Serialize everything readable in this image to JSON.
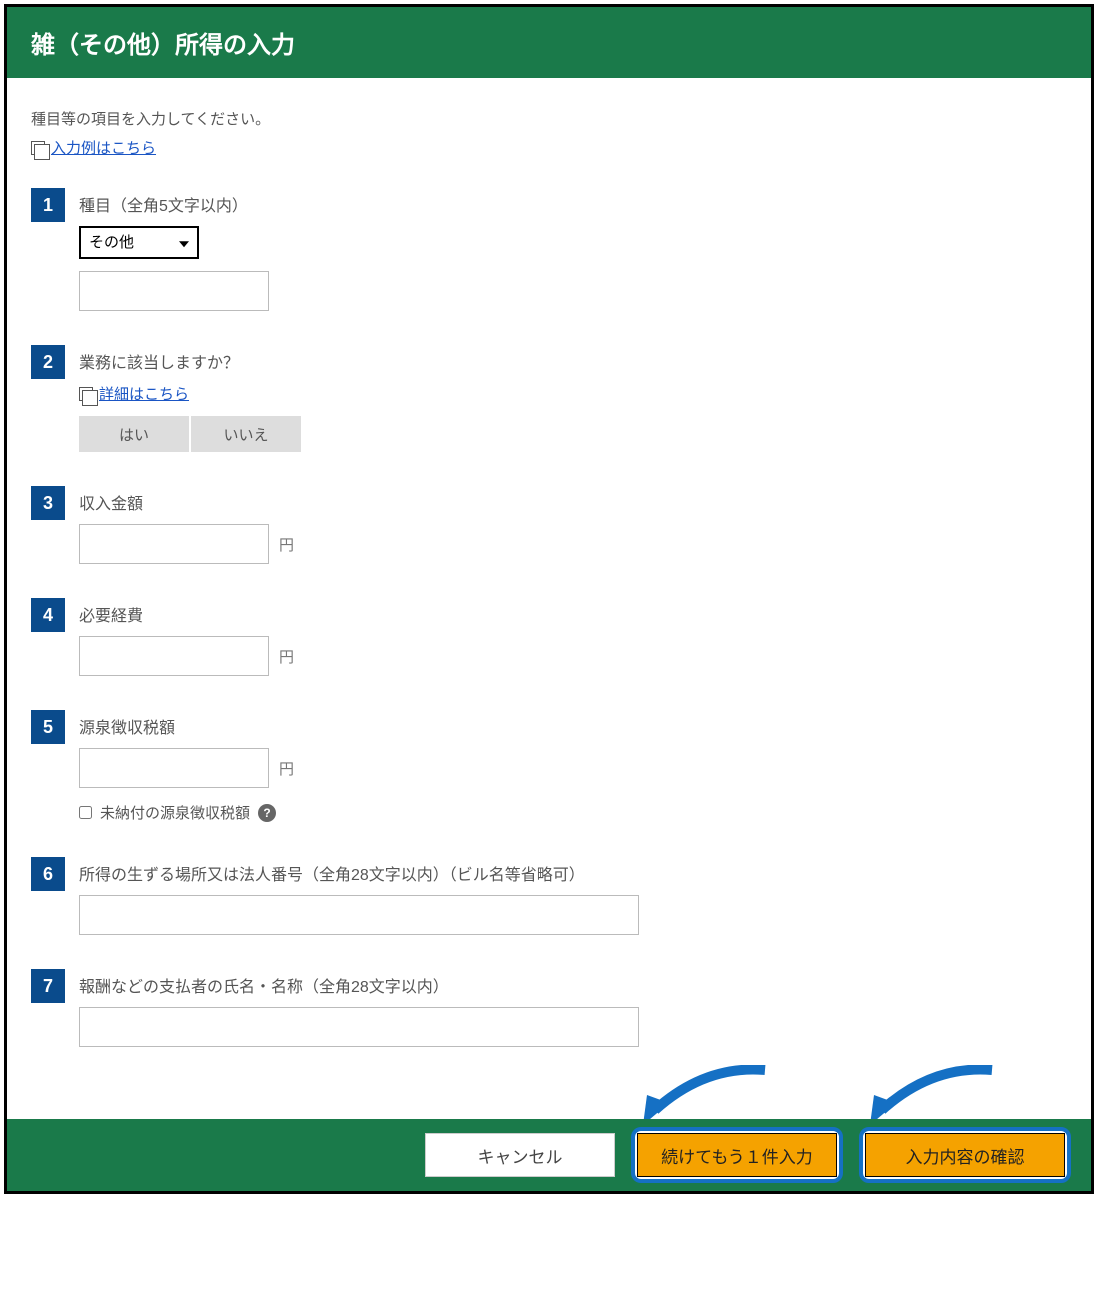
{
  "header": {
    "title": "雑（その他）所得の入力"
  },
  "intro": {
    "text": "種目等の項目を入力してください。",
    "example_link": "入力例はこちら"
  },
  "steps": {
    "s1": {
      "num": "1",
      "label": "種目（全角5文字以内）",
      "select_value": "その他"
    },
    "s2": {
      "num": "2",
      "label": "業務に該当しますか？",
      "detail_link": "詳細はこちら",
      "yes": "はい",
      "no": "いいえ"
    },
    "s3": {
      "num": "3",
      "label": "収入金額",
      "unit": "円"
    },
    "s4": {
      "num": "4",
      "label": "必要経費",
      "unit": "円"
    },
    "s5": {
      "num": "5",
      "label": "源泉徴収税額",
      "unit": "円",
      "checkbox_label": "未納付の源泉徴収税額"
    },
    "s6": {
      "num": "6",
      "label": "所得の生ずる場所又は法人番号（全角28文字以内）（ビル名等省略可）"
    },
    "s7": {
      "num": "7",
      "label": "報酬などの支払者の氏名・名称（全角28文字以内）"
    }
  },
  "footer": {
    "cancel": "キャンセル",
    "continue": "続けてもう１件入力",
    "confirm": "入力内容の確認"
  }
}
